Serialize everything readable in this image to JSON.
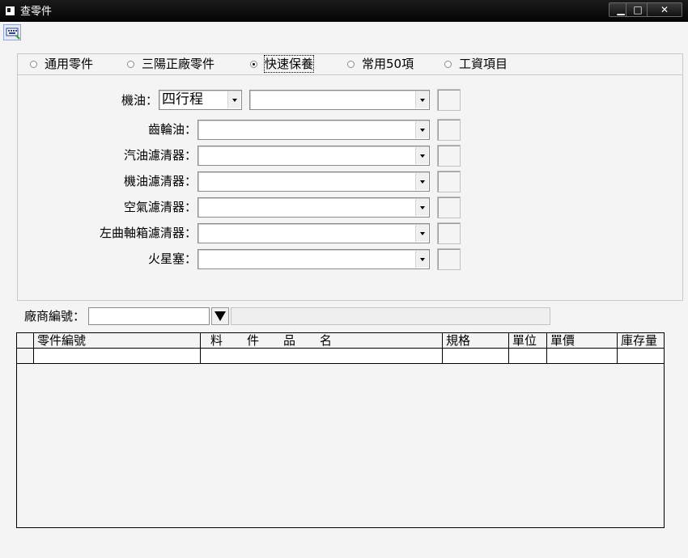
{
  "window": {
    "title": "查零件",
    "controls": {
      "minimize": "▁",
      "maximize": "□",
      "close": "✕"
    }
  },
  "toolbar": {
    "icon": "keyboard-icon"
  },
  "categories": [
    {
      "label": "通用零件",
      "checked": false
    },
    {
      "label": "三陽正廠零件",
      "checked": false
    },
    {
      "label": "快速保養",
      "checked": true
    },
    {
      "label": "常用50項",
      "checked": false
    },
    {
      "label": "工資項目",
      "checked": false
    }
  ],
  "parts": {
    "oil": {
      "label": "機油：",
      "type_value": "四行程",
      "value": ""
    },
    "rows": [
      {
        "label": "齒輪油：",
        "value": ""
      },
      {
        "label": "汽油濾清器：",
        "value": ""
      },
      {
        "label": "機油濾清器：",
        "value": ""
      },
      {
        "label": "空氣濾清器：",
        "value": ""
      },
      {
        "label": "左曲軸箱濾清器：",
        "value": ""
      },
      {
        "label": "火星塞：",
        "value": ""
      }
    ]
  },
  "supplier": {
    "label": "廠商編號：",
    "code": "",
    "name": ""
  },
  "grid": {
    "columns": [
      "零件編號",
      "料　　件　　品　　名",
      "規格",
      "單位",
      "單價",
      "庫存量"
    ],
    "rows": []
  }
}
